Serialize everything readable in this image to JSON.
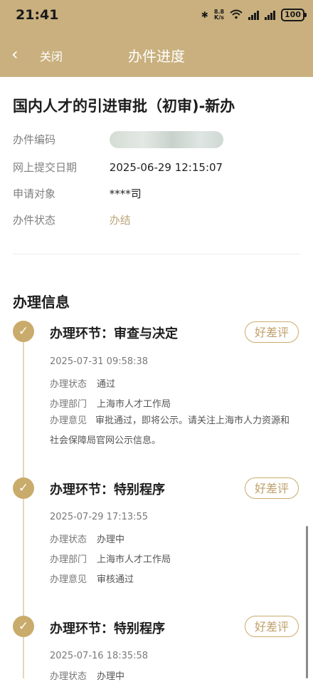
{
  "status_bar": {
    "time": "21:41",
    "net_speed_value": "8.8",
    "net_speed_unit": "K/s",
    "battery": "100"
  },
  "nav": {
    "close_label": "关闭",
    "title": "办件进度"
  },
  "application": {
    "title": "国内人才的引进审批（初审)-新办",
    "fields": [
      {
        "label": "办件编码",
        "value": ""
      },
      {
        "label": "网上提交日期",
        "value": "2025-06-29 12:15:07"
      },
      {
        "label": "申请对象",
        "value": "****司"
      },
      {
        "label": "办件状态",
        "value": "办结"
      }
    ]
  },
  "processing": {
    "section_title": "办理信息",
    "steps": [
      {
        "title": "办理环节：审查与决定",
        "rate_label": "好差评",
        "time": "2025-07-31 09:58:38",
        "status_label": "办理状态",
        "status": "通过",
        "dept_label": "办理部门",
        "dept": "上海市人才工作局",
        "opinion_label": "办理意见",
        "opinion": "审批通过，即将公示。请关注上海市人力资源和社会保障局官网公示信息。"
      },
      {
        "title": "办理环节：特别程序",
        "rate_label": "好差评",
        "time": "2025-07-29 17:13:55",
        "status_label": "办理状态",
        "status": "办理中",
        "dept_label": "办理部门",
        "dept": "上海市人才工作局",
        "opinion_label": "办理意见",
        "opinion": "审核通过"
      },
      {
        "title": "办理环节：特别程序",
        "rate_label": "好差评",
        "time": "2025-07-16 18:35:58",
        "status_label": "办理状态",
        "status": "办理中"
      }
    ]
  },
  "colors": {
    "header": "#c9b07e",
    "accent": "#c9ab6b",
    "status_done": "#bda57a"
  }
}
